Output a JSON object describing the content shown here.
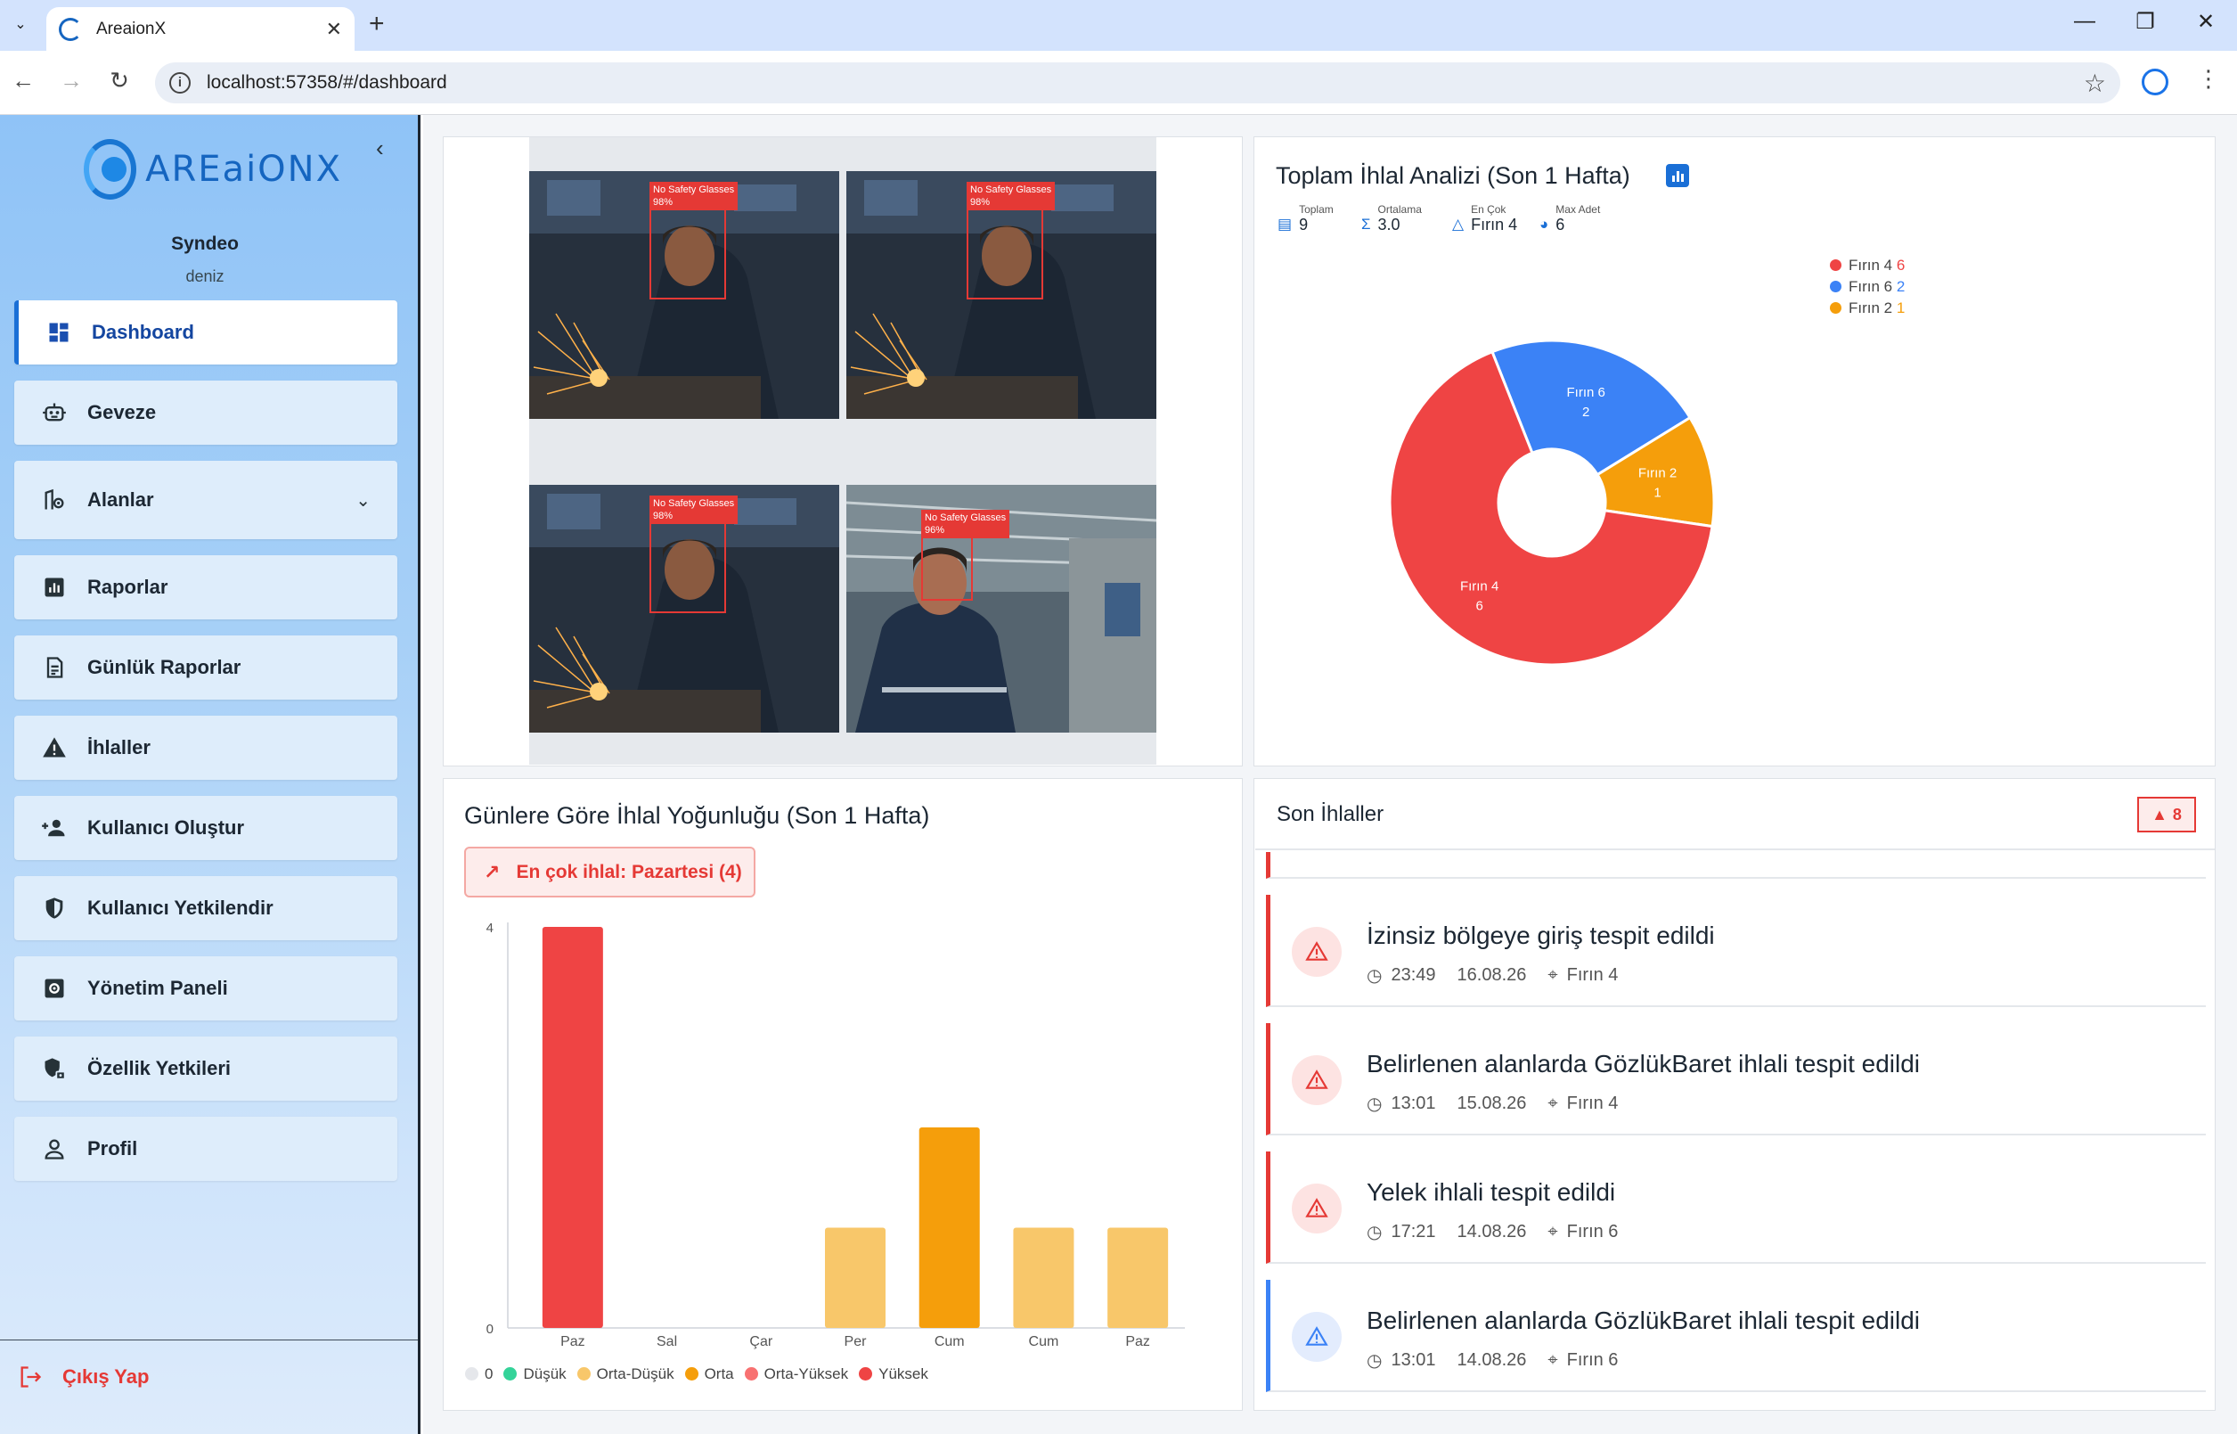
{
  "browser": {
    "tab_title": "AreaionX",
    "url": "localhost:57358/#/dashboard"
  },
  "sidebar": {
    "logo_text": "AREaiONX",
    "user_name": "Syndeo",
    "user_role": "deniz",
    "items": [
      {
        "label": "Dashboard",
        "icon": "dashboard-icon",
        "active": true
      },
      {
        "label": "Geveze",
        "icon": "robot-icon"
      },
      {
        "label": "Alanlar",
        "icon": "area-settings-icon",
        "expandable": true
      },
      {
        "label": "Raporlar",
        "icon": "report-chart-icon"
      },
      {
        "label": "Günlük Raporlar",
        "icon": "daily-report-icon"
      },
      {
        "label": "İhlaller",
        "icon": "warning-icon"
      },
      {
        "label": "Kullanıcı Oluştur",
        "icon": "add-user-icon"
      },
      {
        "label": "Kullanıcı Yetkilendir",
        "icon": "shield-icon"
      },
      {
        "label": "Yönetim Paneli",
        "icon": "admin-settings-icon"
      },
      {
        "label": "Özellik Yetkileri",
        "icon": "feature-lock-icon"
      },
      {
        "label": "Profil",
        "icon": "person-icon"
      }
    ],
    "logout_label": "Çıkış Yap"
  },
  "cameras": [
    {
      "label": "No Safety Glasses",
      "confidence": "98%"
    },
    {
      "label": "No Safety Glasses",
      "confidence": "98%"
    },
    {
      "label": "No Safety Glasses",
      "confidence": "98%"
    },
    {
      "label": "No Safety Glasses",
      "confidence": "96%"
    }
  ],
  "pie_card": {
    "title": "Toplam İhlal Analizi (Son 1 Hafta)",
    "stats": [
      {
        "label": "Toplam",
        "value": "9",
        "icon": "document-icon"
      },
      {
        "label": "Ortalama",
        "value": "3.0",
        "icon": "sigma-icon"
      },
      {
        "label": "En Çok",
        "value": "Fırın 4",
        "icon": "warning-outline-icon"
      },
      {
        "label": "Max Adet",
        "value": "6",
        "icon": "pie-icon"
      }
    ],
    "legend": [
      {
        "name": "Fırın 4",
        "value": "6",
        "color": "#ef4444"
      },
      {
        "name": "Fırın 6",
        "value": "2",
        "color": "#3b82f6"
      },
      {
        "name": "Fırın 2",
        "value": "1",
        "color": "#f59e0b"
      }
    ]
  },
  "bar_card": {
    "title": "Günlere Göre İhlal Yoğunluğu (Son 1 Hafta)",
    "highlight": "En çok ihlal: Pazartesi (4)",
    "legend": [
      {
        "name": "0",
        "color": "#e5e7eb"
      },
      {
        "name": "Düşük",
        "color": "#34d399"
      },
      {
        "name": "Orta-Düşük",
        "color": "#f8c76a"
      },
      {
        "name": "Orta",
        "color": "#f59e0b"
      },
      {
        "name": "Orta-Yüksek",
        "color": "#f87171"
      },
      {
        "name": "Yüksek",
        "color": "#ef4444"
      }
    ]
  },
  "chart_data": [
    {
      "type": "pie",
      "title": "Toplam İhlal Analizi (Son 1 Hafta)",
      "categories": [
        "Fırın 4",
        "Fırın 6",
        "Fırın 2"
      ],
      "values": [
        6,
        2,
        1
      ],
      "colors": [
        "#ef4444",
        "#3b82f6",
        "#f59e0b"
      ],
      "donut": true,
      "legend": "top-right"
    },
    {
      "type": "bar",
      "title": "Günlere Göre İhlal Yoğunluğu (Son 1 Hafta)",
      "categories": [
        "Paz",
        "Sal",
        "Çar",
        "Per",
        "Cum",
        "Cum",
        "Paz"
      ],
      "values": [
        4,
        0,
        0,
        1,
        2,
        1,
        1
      ],
      "colors": [
        "#ef4444",
        "#e5e7eb",
        "#e5e7eb",
        "#f8c76a",
        "#f59e0b",
        "#f8c76a",
        "#f8c76a"
      ],
      "ylim": [
        0,
        4
      ],
      "yticks": [
        "0",
        "4"
      ],
      "legend": "bottom"
    }
  ],
  "alerts_card": {
    "title": "Son İhlaller",
    "count": "8",
    "items": [
      {
        "title": "İzinsiz bölgeye giriş tespit edildi",
        "time": "23:49",
        "date": "16.08.26",
        "location": "Fırın 4",
        "color": "#e53935"
      },
      {
        "title": "Belirlenen alanlarda GözlükBaret ihlali tespit edildi",
        "time": "13:01",
        "date": "15.08.26",
        "location": "Fırın 4",
        "color": "#e53935"
      },
      {
        "title": "Yelek ihlali tespit edildi",
        "time": "17:21",
        "date": "14.08.26",
        "location": "Fırın 6",
        "color": "#e53935"
      },
      {
        "title": "Belirlenen alanlarda GözlükBaret ihlali tespit edildi",
        "time": "13:01",
        "date": "14.08.26",
        "location": "Fırın 6",
        "color": "#3b82f6"
      }
    ]
  }
}
